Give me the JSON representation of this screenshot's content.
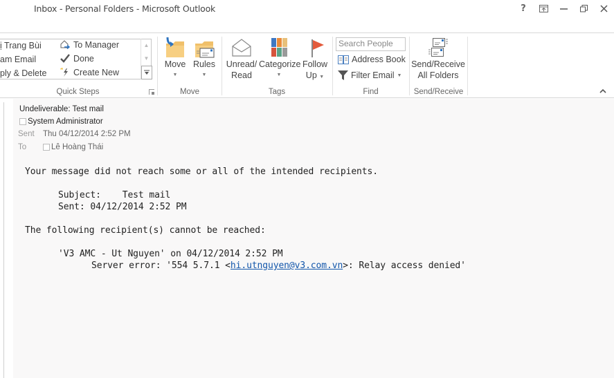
{
  "window": {
    "title": "Inbox - Personal Folders - Microsoft Outlook",
    "controls": {
      "help": "?",
      "ribbon_display": "⇪",
      "minimize": "—",
      "restore": "❐",
      "close": "✕"
    }
  },
  "ribbon": {
    "quick_steps": {
      "left_column": [
        "ị Trang Bùi",
        "am Email",
        "ply & Delete"
      ],
      "right_column": [
        {
          "label": "To Manager",
          "icon": "to-manager-icon"
        },
        {
          "label": "Done",
          "icon": "checkmark-icon"
        },
        {
          "label": "Create New",
          "icon": "create-new-icon"
        }
      ],
      "group_label": "Quick Steps"
    },
    "move_group": {
      "move_label": "Move",
      "rules_label": "Rules",
      "group_label": "Move"
    },
    "tags_group": {
      "unread_label_1": "Unread/",
      "unread_label_2": "Read",
      "categorize_label": "Categorize",
      "followup_label_1": "Follow",
      "followup_label_2": "Up",
      "group_label": "Tags",
      "category_colors": [
        "#3f78c2",
        "#e98b3a",
        "#e8c07a",
        "#d6543c",
        "#5ba386",
        "#9a9a9a"
      ],
      "flag_color": "#e35a3c"
    },
    "find_group": {
      "search_placeholder": "Search People",
      "address_book_label": "Address Book",
      "filter_email_label": "Filter Email",
      "group_label": "Find"
    },
    "send_receive_group": {
      "button_label_1": "Send/Receive",
      "button_label_2": "All Folders",
      "group_label": "Send/Receive"
    }
  },
  "message": {
    "subject": "Undeliverable: Test mail",
    "from": "System Administrator",
    "sent_label": "Sent",
    "sent_value": "Thu 04/12/2014 2:52 PM",
    "to_label": "To",
    "to_value": "Lê Hoàng Thái",
    "body": {
      "line1": "Your message did not reach some or all of the intended recipients.",
      "line2": "Subject:    Test mail",
      "line3": "Sent: 04/12/2014 2:52 PM",
      "line4": "The following recipient(s) cannot be reached:",
      "line5": "'V3 AMC - Ut Nguyen' on 04/12/2014 2:52 PM",
      "line6_prefix": "Server error: '554 5.7.1 <",
      "line6_link": "hi.utnguyen@v3.com.vn",
      "line6_suffix": ">: Relay access denied'"
    }
  }
}
